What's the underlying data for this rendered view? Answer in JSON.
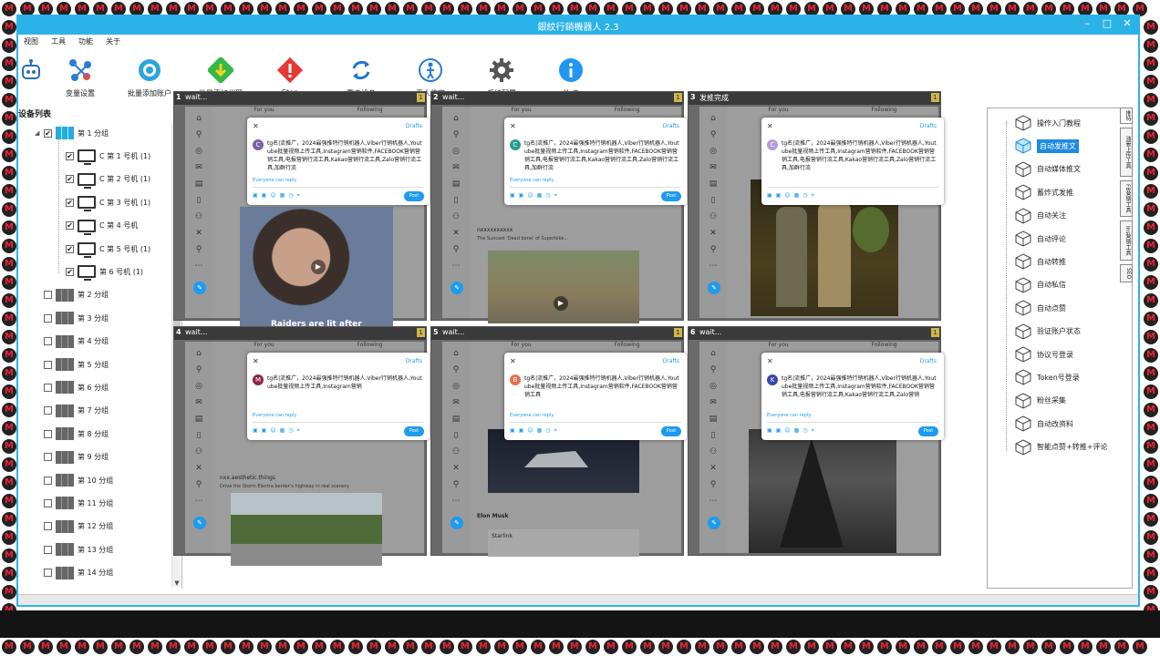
{
  "window": {
    "title": "銀紋行銷機器人 2.3",
    "controls": [
      "–",
      "□",
      "✕"
    ]
  },
  "menu": [
    "视图",
    "工具",
    "功能",
    "关于"
  ],
  "toolbar": [
    {
      "label": "",
      "icon": "robot-icon"
    },
    {
      "label": "变量设置",
      "icon": "variable-settings-icon"
    },
    {
      "label": "批量添加账户",
      "icon": "add-accounts-icon"
    },
    {
      "label": "批量添加代理",
      "icon": "add-proxy-icon"
    },
    {
      "label": "Stop",
      "icon": "stop-icon"
    },
    {
      "label": "重启设备",
      "icon": "restart-icon"
    },
    {
      "label": "无人值守",
      "icon": "unattended-icon"
    },
    {
      "label": "系统配置",
      "icon": "gear-icon"
    },
    {
      "label": "关 于",
      "icon": "info-icon"
    }
  ],
  "device_panel": {
    "title": "设备列表",
    "groups": [
      {
        "label": "第 1 分组",
        "checked": true,
        "expanded": true,
        "devices": [
          {
            "label": "C 第 1 号机 (1)",
            "checked": true
          },
          {
            "label": "C 第 2 号机 (1)",
            "checked": true
          },
          {
            "label": "C 第 3 号机 (1)",
            "checked": true
          },
          {
            "label": "C 第 4 号机",
            "checked": true
          },
          {
            "label": "C 第 5 号机 (1)",
            "checked": true
          },
          {
            "label": "第 6 号机 (1)",
            "checked": true
          }
        ]
      },
      {
        "label": "第 2 分组",
        "checked": false
      },
      {
        "label": "第 3 分组",
        "checked": false
      },
      {
        "label": "第 4 分组",
        "checked": false
      },
      {
        "label": "第 5 分组",
        "checked": false
      },
      {
        "label": "第 6 分组",
        "checked": false
      },
      {
        "label": "第 7 分组",
        "checked": false
      },
      {
        "label": "第 8 分组",
        "checked": false
      },
      {
        "label": "第 9 分组",
        "checked": false
      },
      {
        "label": "第 10 分组",
        "checked": false
      },
      {
        "label": "第 11 分组",
        "checked": false
      },
      {
        "label": "第 12 分组",
        "checked": false
      },
      {
        "label": "第 13 分组",
        "checked": false
      },
      {
        "label": "第 14 分组",
        "checked": false
      }
    ]
  },
  "screens": [
    {
      "num": "1",
      "status": "wait...",
      "flag": "1",
      "tab1": "For you",
      "tab2": "Following",
      "avatar_letter": "C",
      "avatar_color": "#7b5ea7",
      "draft_text": "tg名|流推广，2024最强推特行销机器人,Viber行销机器人,Youtube批量视频上传工具,Instagram营销软件,FACEBOOK营销营销工具,电报营销行流工具,Kakao营销行流工具,Zalo营销行流工具,加群行流",
      "reply": "Everyone can reply",
      "drafts": "Drafts",
      "post": "Post",
      "caption": "Raiders are lit after"
    },
    {
      "num": "2",
      "status": "wait...",
      "flag": "1",
      "tab1": "For you",
      "tab2": "Following",
      "avatar_letter": "C",
      "avatar_color": "#2a9d8f",
      "draft_text": "tg名|流推广，2024最强推特行销机器人,Viber行销机器人,Youtube批量视频上传工具,Instagram营销软件,FACEBOOK营销营销工具,电报营销行流工具,Kakao营销行流工具,Zalo营销行流工具,加群行流",
      "reply": "Everyone can reply",
      "drafts": "Drafts",
      "post": "Post",
      "tweet_user": "nxxxxxxxxxx",
      "tweet_text": "The Suncast 'Dead bone' of Superbike..."
    },
    {
      "num": "3",
      "status": "发推完成",
      "flag": "1",
      "tab1": "For you",
      "tab2": "Following",
      "avatar_letter": "C",
      "avatar_color": "#b39ddb",
      "draft_text": "tg名|流推广，2024最强推特行销机器人,Viber行销机器人,Youtube批量视频上传工具,Instagram营销软件,FACEBOOK营销营销工具,电报营销行流工具,Kakao营销行流工具,Zalo营销行流工具,加群行流",
      "reply": "",
      "drafts": "Drafts",
      "post": ""
    },
    {
      "num": "4",
      "status": "wait...",
      "flag": "1",
      "tab1": "For you",
      "tab2": "Following",
      "avatar_letter": "M",
      "avatar_color": "#8e244d",
      "draft_text": "tg名|流推广，2024最强推特行销机器人,Viber行销机器人,Youtube批量视频上传工具,Instagram营销",
      "reply": "Everyone can reply",
      "drafts": "Drafts",
      "post": "Post",
      "tweet_user": "nxx.aesthetic.things",
      "tweet_text": "Drive the Storm Electra border's highway in real scenery"
    },
    {
      "num": "5",
      "status": "wait...",
      "flag": "1",
      "tab1": "For you",
      "tab2": "Following",
      "avatar_letter": "B",
      "avatar_color": "#e76f51",
      "draft_text": "tg名|流推广，2024最强推特行销机器人,Viber行销机器人,Youtube批量视频上传工具,Instagram营销软件,FACEBOOK营销营销工具",
      "reply": "Everyone can reply",
      "drafts": "Drafts",
      "post": "Post",
      "tweet_user": "Elon Musk",
      "tweet_text": "Starlink"
    },
    {
      "num": "6",
      "status": "wait...",
      "flag": "1",
      "tab1": "For you",
      "tab2": "Following",
      "avatar_letter": "K",
      "avatar_color": "#3949ab",
      "draft_text": "tg名|流推广，2024最强推特行销机器人,Viber行销机器人,Youtube批量视频上传工具,Instagram营销软件,FACEBOOK营销营销工具,电报营销行流工具,Kakao营销行流工具,Zalo营销",
      "reply": "Everyone can reply",
      "drafts": "Drafts",
      "post": "Post"
    }
  ],
  "functions": {
    "items": [
      "操作入门教程",
      "自动发推文",
      "自动媒体推文",
      "蓄炸式发推",
      "自动关注",
      "自动评论",
      "自动转推",
      "自动私信",
      "自动点赞",
      "验证账户状态",
      "协议号登录",
      "Token号登录",
      "粉丝采集",
      "自动改资料",
      "智能点赞+转推+评论"
    ],
    "selected_index": 1
  },
  "side_tabs": [
    "推特",
    "油管上传工具",
    "FB营销工具",
    "Ins营销工具",
    "SEO"
  ],
  "colors": {
    "accent": "#2bb3e8",
    "selected": "#1d8be0",
    "twitter_blue": "#1d9bf0"
  }
}
